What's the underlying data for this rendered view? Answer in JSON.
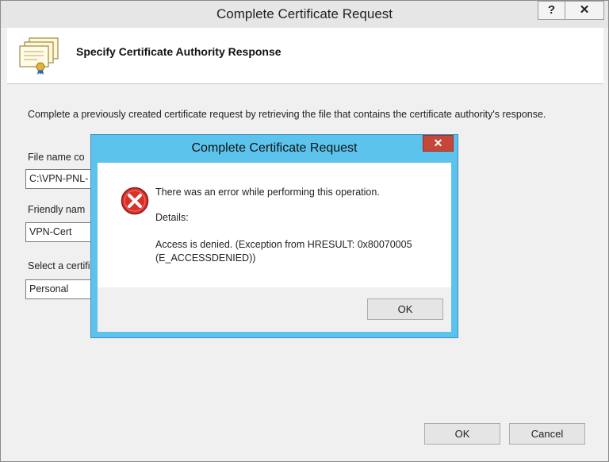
{
  "window": {
    "title": "Complete Certificate Request",
    "help_label": "?",
    "close_label": "✕"
  },
  "header": {
    "title": "Specify Certificate Authority Response",
    "icon": "certificate-icon"
  },
  "content": {
    "description": "Complete a previously created certificate request by retrieving the file that contains the certificate authority's response.",
    "file_name_label": "File name co",
    "file_name_value": "C:\\VPN-PNL-",
    "friendly_name_label": "Friendly nam",
    "friendly_name_value": "VPN-Cert",
    "store_label": "Select a certifi",
    "store_value": "Personal"
  },
  "buttons": {
    "ok": "OK",
    "cancel": "Cancel"
  },
  "dialog": {
    "title": "Complete Certificate Request",
    "close_label": "✕",
    "icon": "error-icon",
    "message": "There was an error while performing this operation.",
    "details_label": "Details:",
    "details_line1": "Access is denied. (Exception from HRESULT: 0x80070005",
    "details_line2": "(E_ACCESSDENIED))",
    "ok": "OK"
  },
  "colors": {
    "dialog_frame": "#5cc4ec",
    "close_red": "#c7463a",
    "error_red": "#d9302a"
  }
}
